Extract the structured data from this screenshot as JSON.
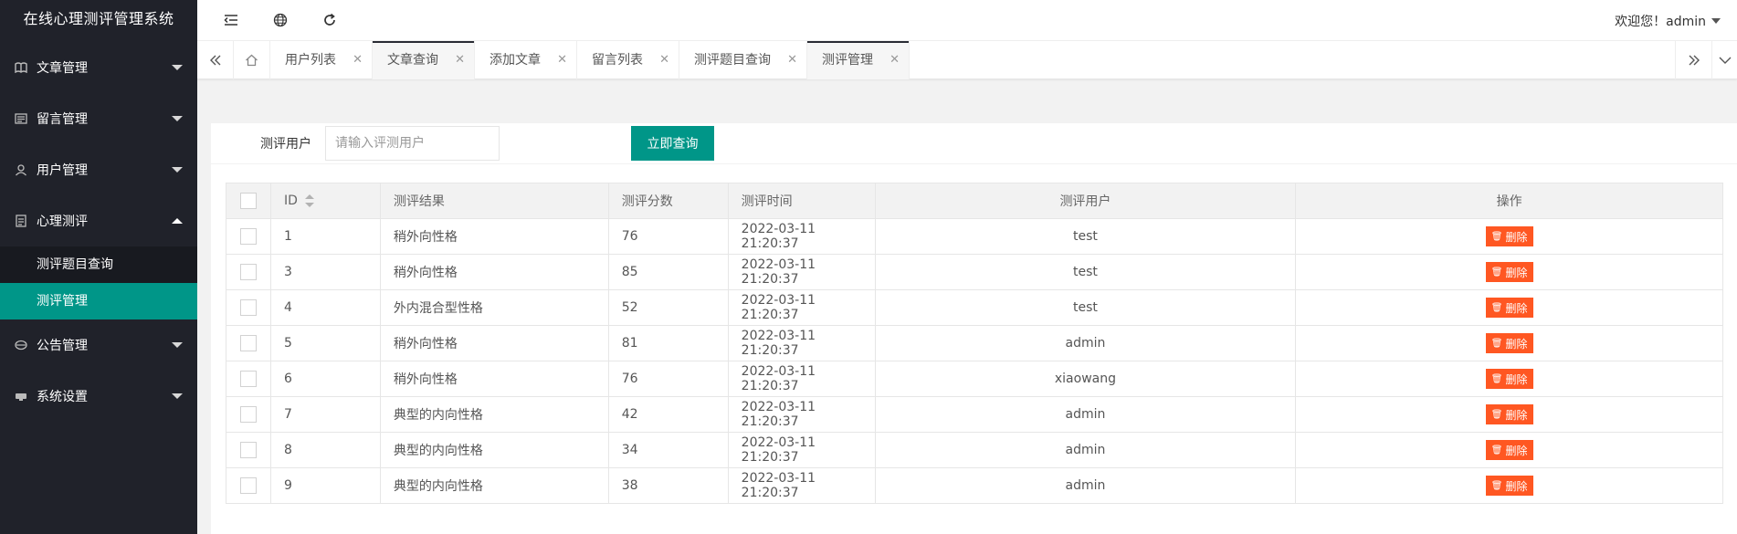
{
  "app": {
    "title": "在线心理测评管理系统"
  },
  "header": {
    "welcome": "欢迎您！admin"
  },
  "sidebar": {
    "items": [
      {
        "label": "文章管理",
        "icon": "book-icon"
      },
      {
        "label": "留言管理",
        "icon": "message-icon"
      },
      {
        "label": "用户管理",
        "icon": "user-icon"
      },
      {
        "label": "心理测评",
        "icon": "survey-icon",
        "expanded": true
      },
      {
        "label": "公告管理",
        "icon": "notice-icon"
      },
      {
        "label": "系统设置",
        "icon": "settings-icon"
      }
    ],
    "submenu": [
      {
        "label": "测评题目查询",
        "active": false
      },
      {
        "label": "测评管理",
        "active": true
      }
    ]
  },
  "tabs": [
    {
      "label": "用户列表"
    },
    {
      "label": "文章查询"
    },
    {
      "label": "添加文章"
    },
    {
      "label": "留言列表"
    },
    {
      "label": "测评题目查询"
    },
    {
      "label": "测评管理"
    }
  ],
  "search": {
    "label": "测评用户",
    "placeholder": "请输入评测用户",
    "button": "立即查询"
  },
  "table": {
    "headers": [
      "ID",
      "测评结果",
      "测评分数",
      "测评时间",
      "测评用户",
      "操作"
    ],
    "delete_label": "删除",
    "rows": [
      {
        "id": "1",
        "result": "稍外向性格",
        "score": "76",
        "time": "2022-03-11 21:20:37",
        "user": "test"
      },
      {
        "id": "3",
        "result": "稍外向性格",
        "score": "85",
        "time": "2022-03-11 21:20:37",
        "user": "test"
      },
      {
        "id": "4",
        "result": "外内混合型性格",
        "score": "52",
        "time": "2022-03-11 21:20:37",
        "user": "test"
      },
      {
        "id": "5",
        "result": "稍外向性格",
        "score": "81",
        "time": "2022-03-11 21:20:37",
        "user": "admin"
      },
      {
        "id": "6",
        "result": "稍外向性格",
        "score": "76",
        "time": "2022-03-11 21:20:37",
        "user": "xiaowang"
      },
      {
        "id": "7",
        "result": "典型的内向性格",
        "score": "42",
        "time": "2022-03-11 21:20:37",
        "user": "admin"
      },
      {
        "id": "8",
        "result": "典型的内向性格",
        "score": "34",
        "time": "2022-03-11 21:20:37",
        "user": "admin"
      },
      {
        "id": "9",
        "result": "典型的内向性格",
        "score": "38",
        "time": "2022-03-11 21:20:37",
        "user": "admin"
      }
    ]
  },
  "colors": {
    "accent": "#009688",
    "danger": "#ff5722",
    "sidebar": "#20222a"
  }
}
